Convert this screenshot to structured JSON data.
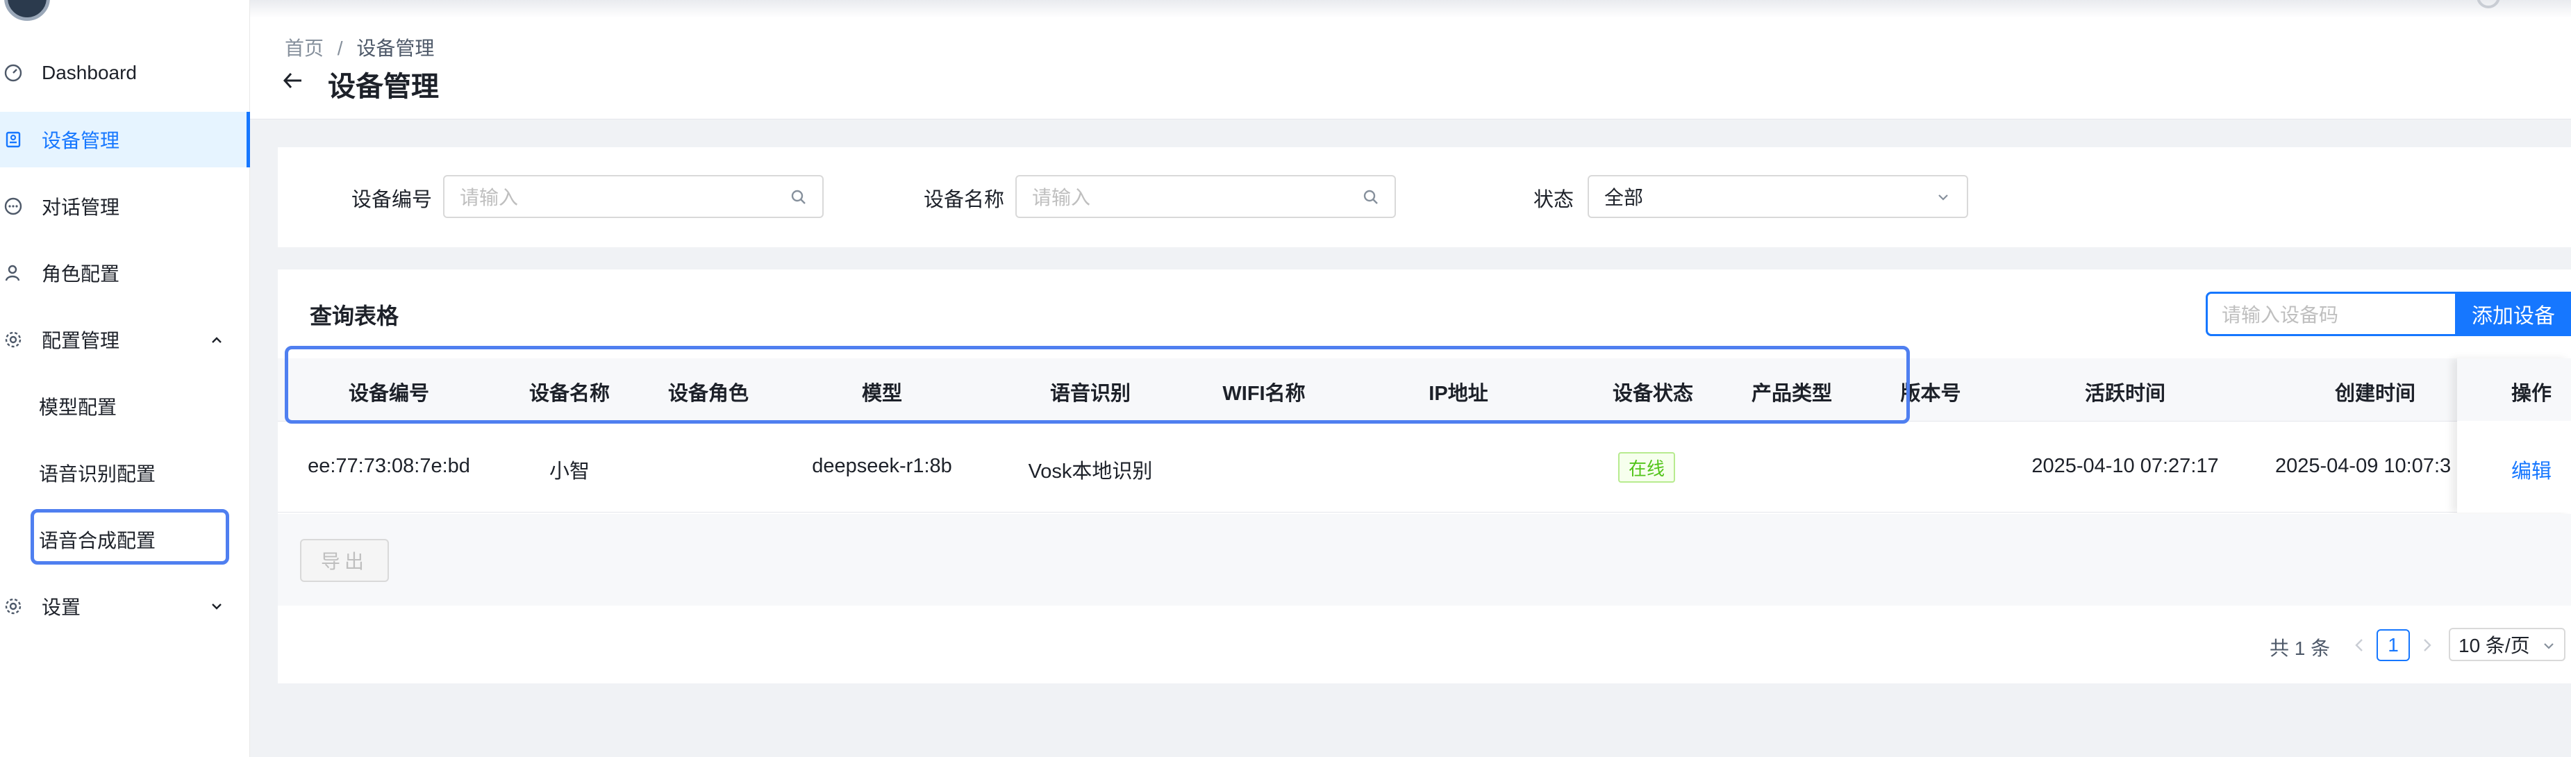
{
  "sidebar": {
    "items": [
      {
        "label": "Dashboard",
        "icon": "gauge-icon"
      },
      {
        "label": "设备管理",
        "icon": "device-icon",
        "active": true
      },
      {
        "label": "对话管理",
        "icon": "chat-icon"
      },
      {
        "label": "角色配置",
        "icon": "user-icon"
      },
      {
        "label": "配置管理",
        "icon": "gear-icon",
        "expanded": true
      },
      {
        "label": "模型配置"
      },
      {
        "label": "语音识别配置"
      },
      {
        "label": "语音合成配置"
      },
      {
        "label": "设置",
        "icon": "gear-icon",
        "expanded": false
      }
    ]
  },
  "header": {
    "breadcrumb_home": "首页",
    "breadcrumb_sep": "/",
    "breadcrumb_current": "设备管理",
    "title": "设备管理"
  },
  "filters": {
    "device_no_label": "设备编号",
    "device_no_placeholder": "请输入",
    "device_name_label": "设备名称",
    "device_name_placeholder": "请输入",
    "status_label": "状态",
    "status_value": "全部"
  },
  "table": {
    "title": "查询表格",
    "search_placeholder": "请输入设备码",
    "add_label": "添加设备",
    "columns": [
      "设备编号",
      "设备名称",
      "设备角色",
      "模型",
      "语音识别",
      "WIFI名称",
      "IP地址",
      "设备状态",
      "产品类型",
      "版本号",
      "活跃时间",
      "创建时间",
      "操作"
    ],
    "rows": [
      {
        "device_no": "ee:77:73:08:7e:bd",
        "device_name": "小智",
        "role": "",
        "model": "deepseek-r1:8b",
        "asr": "Vosk本地识别",
        "wifi": "",
        "ip": "",
        "status": "在线",
        "product_type": "",
        "version": "",
        "active_time": "2025-04-10 07:27:17",
        "created_time": "2025-04-09 10:07:3",
        "action": "编辑"
      }
    ],
    "export_label": "导出"
  },
  "pagination": {
    "total_text": "共 1 条",
    "current_page": "1",
    "page_size": "10 条/页"
  },
  "colors": {
    "primary": "#1677ff",
    "highlight": "#4f7ff0",
    "online": "#52c41a"
  }
}
